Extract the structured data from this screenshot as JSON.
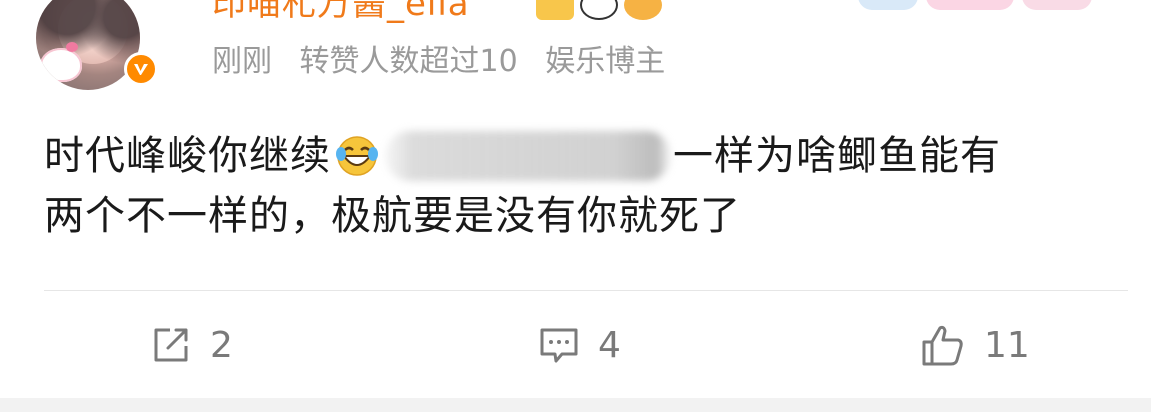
{
  "post": {
    "username": "印喵札万酱_ella",
    "meta": {
      "time": "刚刚",
      "repost_note": "转赞人数超过10",
      "user_tag": "娱乐博主"
    },
    "content": {
      "line1_before": "时代峰峻你继续",
      "line1_after": "一样为啥鲫鱼能有",
      "line2": "两个不一样的，极航要是没有你就死了"
    }
  },
  "actions": {
    "repost_count": "2",
    "comment_count": "4",
    "like_count": "11"
  },
  "colors": {
    "username": "#f07a1a",
    "meta": "#9a9a9a",
    "text": "#1a1a1a",
    "verified_badge": "#ff8a00",
    "icon": "#7a7a7a"
  },
  "icons": {
    "verified": "verified-v-icon",
    "emoji": "laughing-tears-emoji-icon",
    "repost": "share-arrow-icon",
    "comment": "comment-bubble-icon",
    "like": "thumbs-up-icon"
  }
}
